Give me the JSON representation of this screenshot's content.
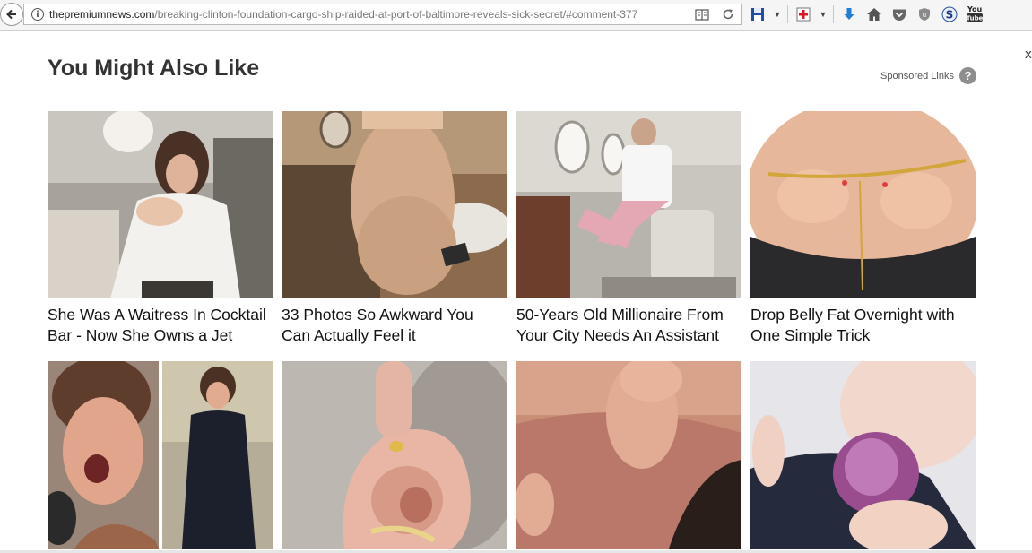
{
  "browser": {
    "url_domain": "thepremiumnews.com",
    "url_path": "/breaking-clinton-foundation-cargo-ship-raided-at-port-of-baltimore-reveals-sick-secret/#comment-377",
    "icons": [
      "back-arrow-icon",
      "info-icon",
      "reader-view-icon",
      "reload-icon",
      "save-disk-icon",
      "first-aid-icon",
      "download-arrow-icon",
      "home-icon",
      "pocket-icon",
      "ublock-shield-icon",
      "s-extension-icon",
      "youtube-icon"
    ]
  },
  "widget": {
    "heading": "You Might Also Like",
    "sponsored_label": "Sponsored Links",
    "help_glyph": "?",
    "close_glyph": "x",
    "cards": [
      {
        "title_line1": "She Was A Waitress In Cocktail",
        "title_line2": "Bar - Now She Owns a Jet",
        "image": "woman-on-private-jet-image"
      },
      {
        "title_line1": "33 Photos So Awkward You",
        "title_line2": "Can Actually Feel it",
        "image": "woman-in-bathroom-image"
      },
      {
        "title_line1": "50-Years Old Millionaire From",
        "title_line2": "Your City Needs An Assistant",
        "image": "man-on-private-jet-image"
      },
      {
        "title_line1": "Drop Belly Fat Overnight with",
        "title_line2": "One Simple Trick",
        "image": "belly-measuring-tape-image"
      },
      {
        "image": "singer-before-after-image"
      },
      {
        "image": "ear-drops-image"
      },
      {
        "image": "pinched-skin-image"
      },
      {
        "image": "onion-on-foot-image"
      }
    ]
  },
  "colors": {
    "heading": "#333333",
    "title": "#111111",
    "toolbar_bg": "#f5f5f5",
    "help_badge": "#8e8e8e"
  }
}
